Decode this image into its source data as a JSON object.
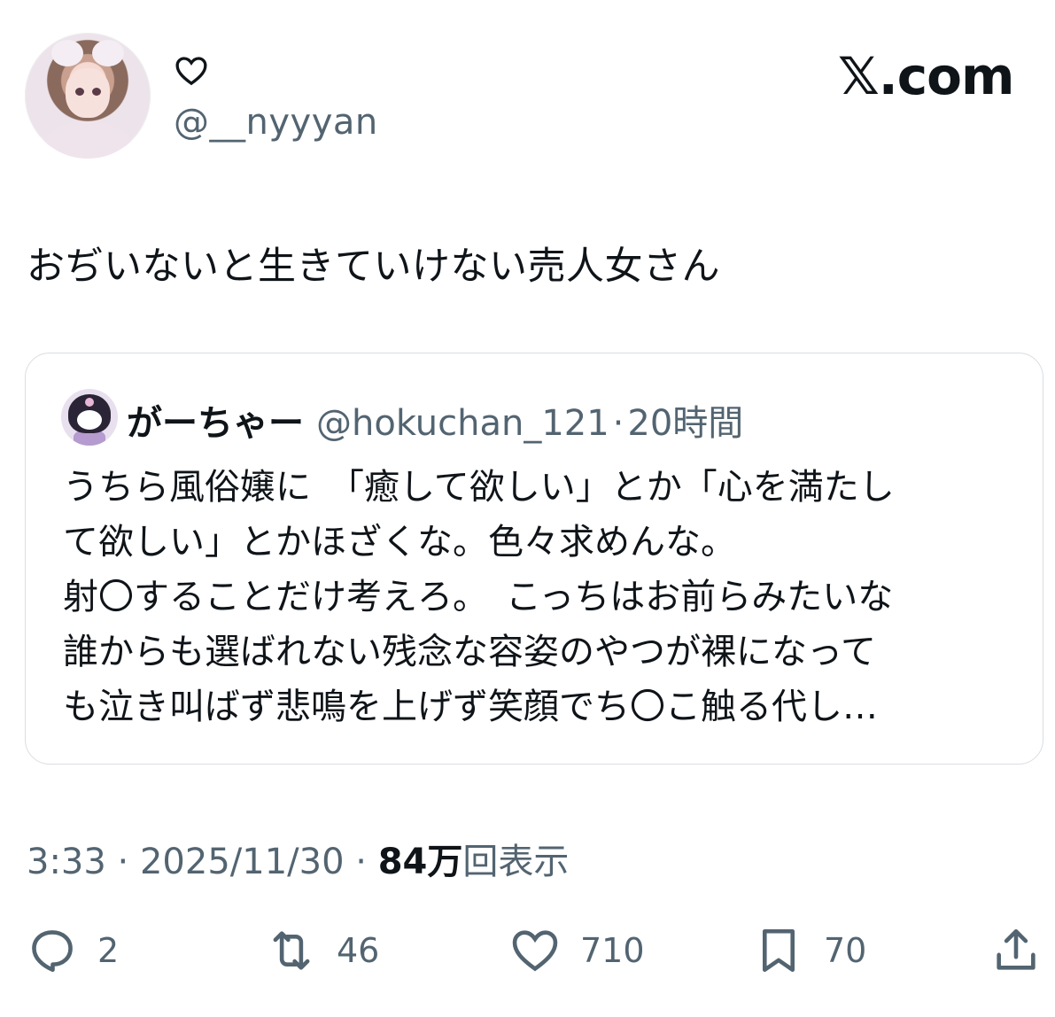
{
  "brand": "𝕏.com",
  "author": {
    "display_name_icon": "heart-outline-icon",
    "handle": "@__nyyyan"
  },
  "tweet": {
    "text": "おぢいないと生きていけない売人女さん",
    "time": "3:33",
    "date": "2025/11/30",
    "views_count": "84万",
    "views_label": "回表示"
  },
  "quote": {
    "name": "がーちゃー",
    "handle": "@hokuchan_121",
    "time_ago": "20時間",
    "lines": [
      "うちら風俗嬢に　「癒して欲しい」とか「心を満たし",
      "て欲しい」とかほざくな。色々求めんな。",
      "射〇することだけ考えろ。　こっちはお前らみたいな",
      "誰からも選ばれない残念な容姿のやつが裸になって",
      "も泣き叫ばず悲鳴を上げず笑顔でち〇こ触る代し…"
    ]
  },
  "actions": {
    "reply_count": "2",
    "retweet_count": "46",
    "like_count": "710",
    "bookmark_count": "70"
  },
  "icons": {
    "reply": "reply-icon",
    "retweet": "retweet-icon",
    "like": "heart-icon",
    "bookmark": "bookmark-icon",
    "share": "share-icon"
  },
  "colors": {
    "text_primary": "#0f1419",
    "text_secondary": "#536471",
    "border": "#d9dee2"
  }
}
